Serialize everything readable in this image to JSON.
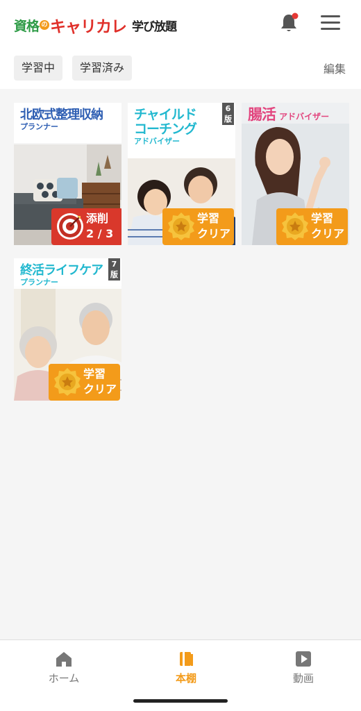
{
  "header": {
    "logo": {
      "shikaku": "資格",
      "no": "の",
      "brand": "キャリカレ",
      "sub": "学び放題"
    },
    "bell_icon": "bell-icon",
    "menu_icon": "hamburger-menu-icon",
    "notification_dot_color": "#e53935"
  },
  "filters": {
    "studying": "学習中",
    "studied": "学習済み"
  },
  "edit_label": "編集",
  "books": [
    {
      "title": "北欧式整理収納",
      "subtitle": "プランナー",
      "title_color": "#2f5fb3",
      "subtitle_color": "#2f5fb3",
      "edition": "",
      "badge": {
        "type": "correction",
        "line1": "添削",
        "line2": "2 / 3",
        "color": "#d9382b"
      }
    },
    {
      "title": "チャイルド",
      "title2": "コーチング",
      "subtitle": "アドバイザー",
      "title_color": "#22b8cf",
      "subtitle_color": "#22b8cf",
      "edition": "6",
      "edition_suffix": "版",
      "badge": {
        "type": "clear",
        "line1": "学習",
        "line2": "クリア",
        "color": "#f39b1a"
      }
    },
    {
      "title": "腸活",
      "subtitle": "アドバイザー",
      "title_color": "#e2457e",
      "subtitle_color": "#e2457e",
      "edition": "",
      "badge": {
        "type": "clear",
        "line1": "学習",
        "line2": "クリア",
        "color": "#f39b1a"
      }
    },
    {
      "title": "終活ライフケア",
      "subtitle": "プランナー",
      "title_color": "#22b8cf",
      "subtitle_color": "#22b8cf",
      "edition": "7",
      "edition_suffix": "版",
      "badge": {
        "type": "clear",
        "line1": "学習",
        "line2": "クリア",
        "color": "#f39b1a"
      }
    }
  ],
  "tabbar": {
    "items": [
      {
        "label": "ホーム",
        "icon": "home-icon"
      },
      {
        "label": "本棚",
        "icon": "bookshelf-icon"
      },
      {
        "label": "動画",
        "icon": "video-play-icon"
      }
    ],
    "active_color": "#f39b1a"
  }
}
